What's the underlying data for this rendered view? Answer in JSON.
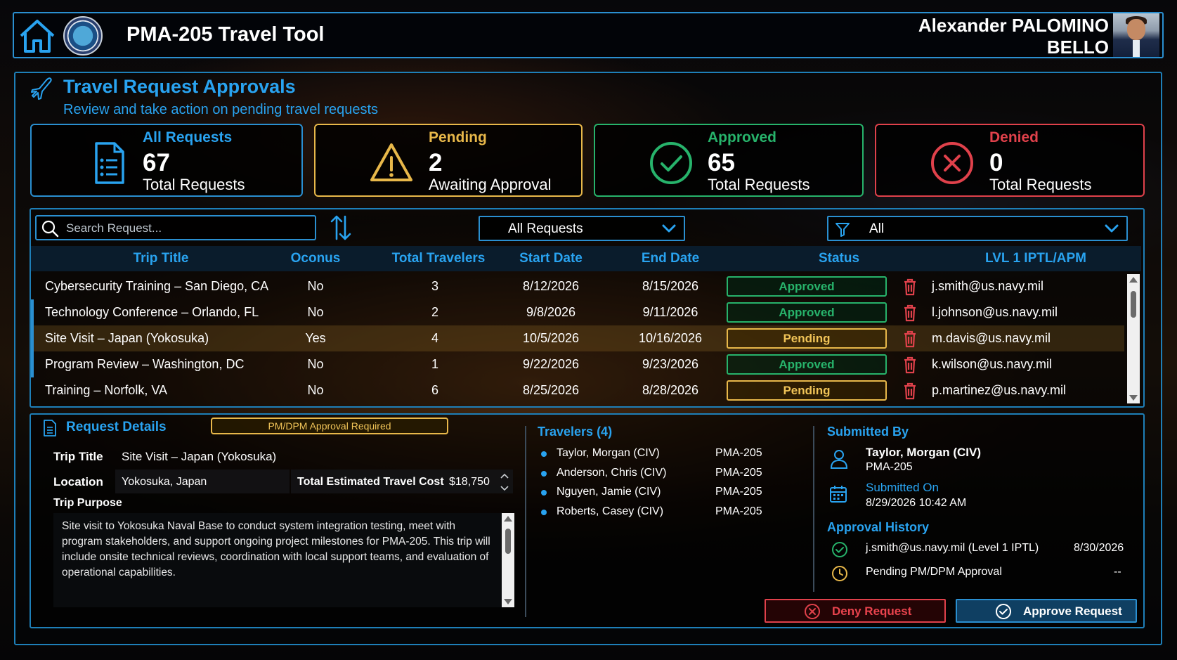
{
  "header": {
    "app_title": "PMA-205 Travel Tool",
    "user_first": "Alexander PALOMINO",
    "user_last": "BELLO"
  },
  "page": {
    "title": "Travel Request Approvals",
    "subtitle": "Review and take action on pending travel requests"
  },
  "cards": {
    "all": {
      "label": "All Requests",
      "value": "67",
      "sub": "Total Requests",
      "color": "#29a3f0",
      "icon": "document-list-icon"
    },
    "pending": {
      "label": "Pending",
      "value": "2",
      "sub": "Awaiting Approval",
      "color": "#e8b84a",
      "icon": "warning-icon"
    },
    "approved": {
      "label": "Approved",
      "value": "65",
      "sub": "Total Requests",
      "color": "#27b36b",
      "icon": "check-circle-icon"
    },
    "denied": {
      "label": "Denied",
      "value": "0",
      "sub": "Total Requests",
      "color": "#e0414b",
      "icon": "x-circle-icon"
    }
  },
  "toolbar": {
    "search_placeholder": "Search Request...",
    "request_filter": "All Requests",
    "status_filter": "All"
  },
  "table": {
    "columns": [
      "Trip Title",
      "Oconus",
      "Total Travelers",
      "Start Date",
      "End Date",
      "Status",
      "LVL 1 IPTL/APM"
    ],
    "rows": [
      {
        "title": "Cybersecurity Training – San Diego, CA",
        "oconus": "No",
        "travelers": "3",
        "start": "8/12/2026",
        "end": "8/15/2026",
        "status": "Approved",
        "email": "j.smith@us.navy.mil"
      },
      {
        "title": "Technology Conference – Orlando, FL",
        "oconus": "No",
        "travelers": "2",
        "start": "9/8/2026",
        "end": "9/11/2026",
        "status": "Approved",
        "email": "l.johnson@us.navy.mil"
      },
      {
        "title": "Site Visit – Japan (Yokosuka)",
        "oconus": "Yes",
        "travelers": "4",
        "start": "10/5/2026",
        "end": "10/16/2026",
        "status": "Pending",
        "email": "m.davis@us.navy.mil"
      },
      {
        "title": "Program Review – Washington, DC",
        "oconus": "No",
        "travelers": "1",
        "start": "9/22/2026",
        "end": "9/23/2026",
        "status": "Approved",
        "email": "k.wilson@us.navy.mil"
      },
      {
        "title": "Training – Norfolk, VA",
        "oconus": "No",
        "travelers": "6",
        "start": "8/25/2026",
        "end": "8/28/2026",
        "status": "Pending",
        "email": "p.martinez@us.navy.mil"
      }
    ]
  },
  "details": {
    "title": "Request Details",
    "badge": "PM/DPM Approval Required",
    "trip_title_label": "Trip Title",
    "trip_title": "Site Visit – Japan (Yokosuka)",
    "location_label": "Location",
    "location": "Yokosuka, Japan",
    "cost_label": "Total Estimated Travel Cost",
    "cost": "$18,750",
    "purpose_label": "Trip Purpose",
    "purpose": "Site visit to Yokosuka Naval Base to conduct system integration testing, meet with program stakeholders, and support ongoing project milestones for PMA-205. This trip will include onsite technical reviews, coordination with local support teams, and evaluation of operational capabilities."
  },
  "travelers": {
    "title": "Travelers (4)",
    "list": [
      {
        "name": "Taylor, Morgan (CIV)",
        "org": "PMA-205"
      },
      {
        "name": "Anderson, Chris (CIV)",
        "org": "PMA-205"
      },
      {
        "name": "Nguyen, Jamie (CIV)",
        "org": "PMA-205"
      },
      {
        "name": "Roberts, Casey (CIV)",
        "org": "PMA-205"
      }
    ]
  },
  "submitted": {
    "title": "Submitted By",
    "name": "Taylor, Morgan (CIV)",
    "org": "PMA-205",
    "on_label": "Submitted On",
    "on_value": "8/29/2026 10:42 AM"
  },
  "history": {
    "title": "Approval History",
    "items": [
      {
        "text": "j.smith@us.navy.mil (Level 1 IPTL)",
        "date": "8/30/2026",
        "icon": "check-circle-icon"
      },
      {
        "text": "Pending PM/DPM Approval",
        "date": "--",
        "icon": "clock-icon"
      }
    ]
  },
  "actions": {
    "deny": "Deny Request",
    "approve": "Approve Request"
  }
}
